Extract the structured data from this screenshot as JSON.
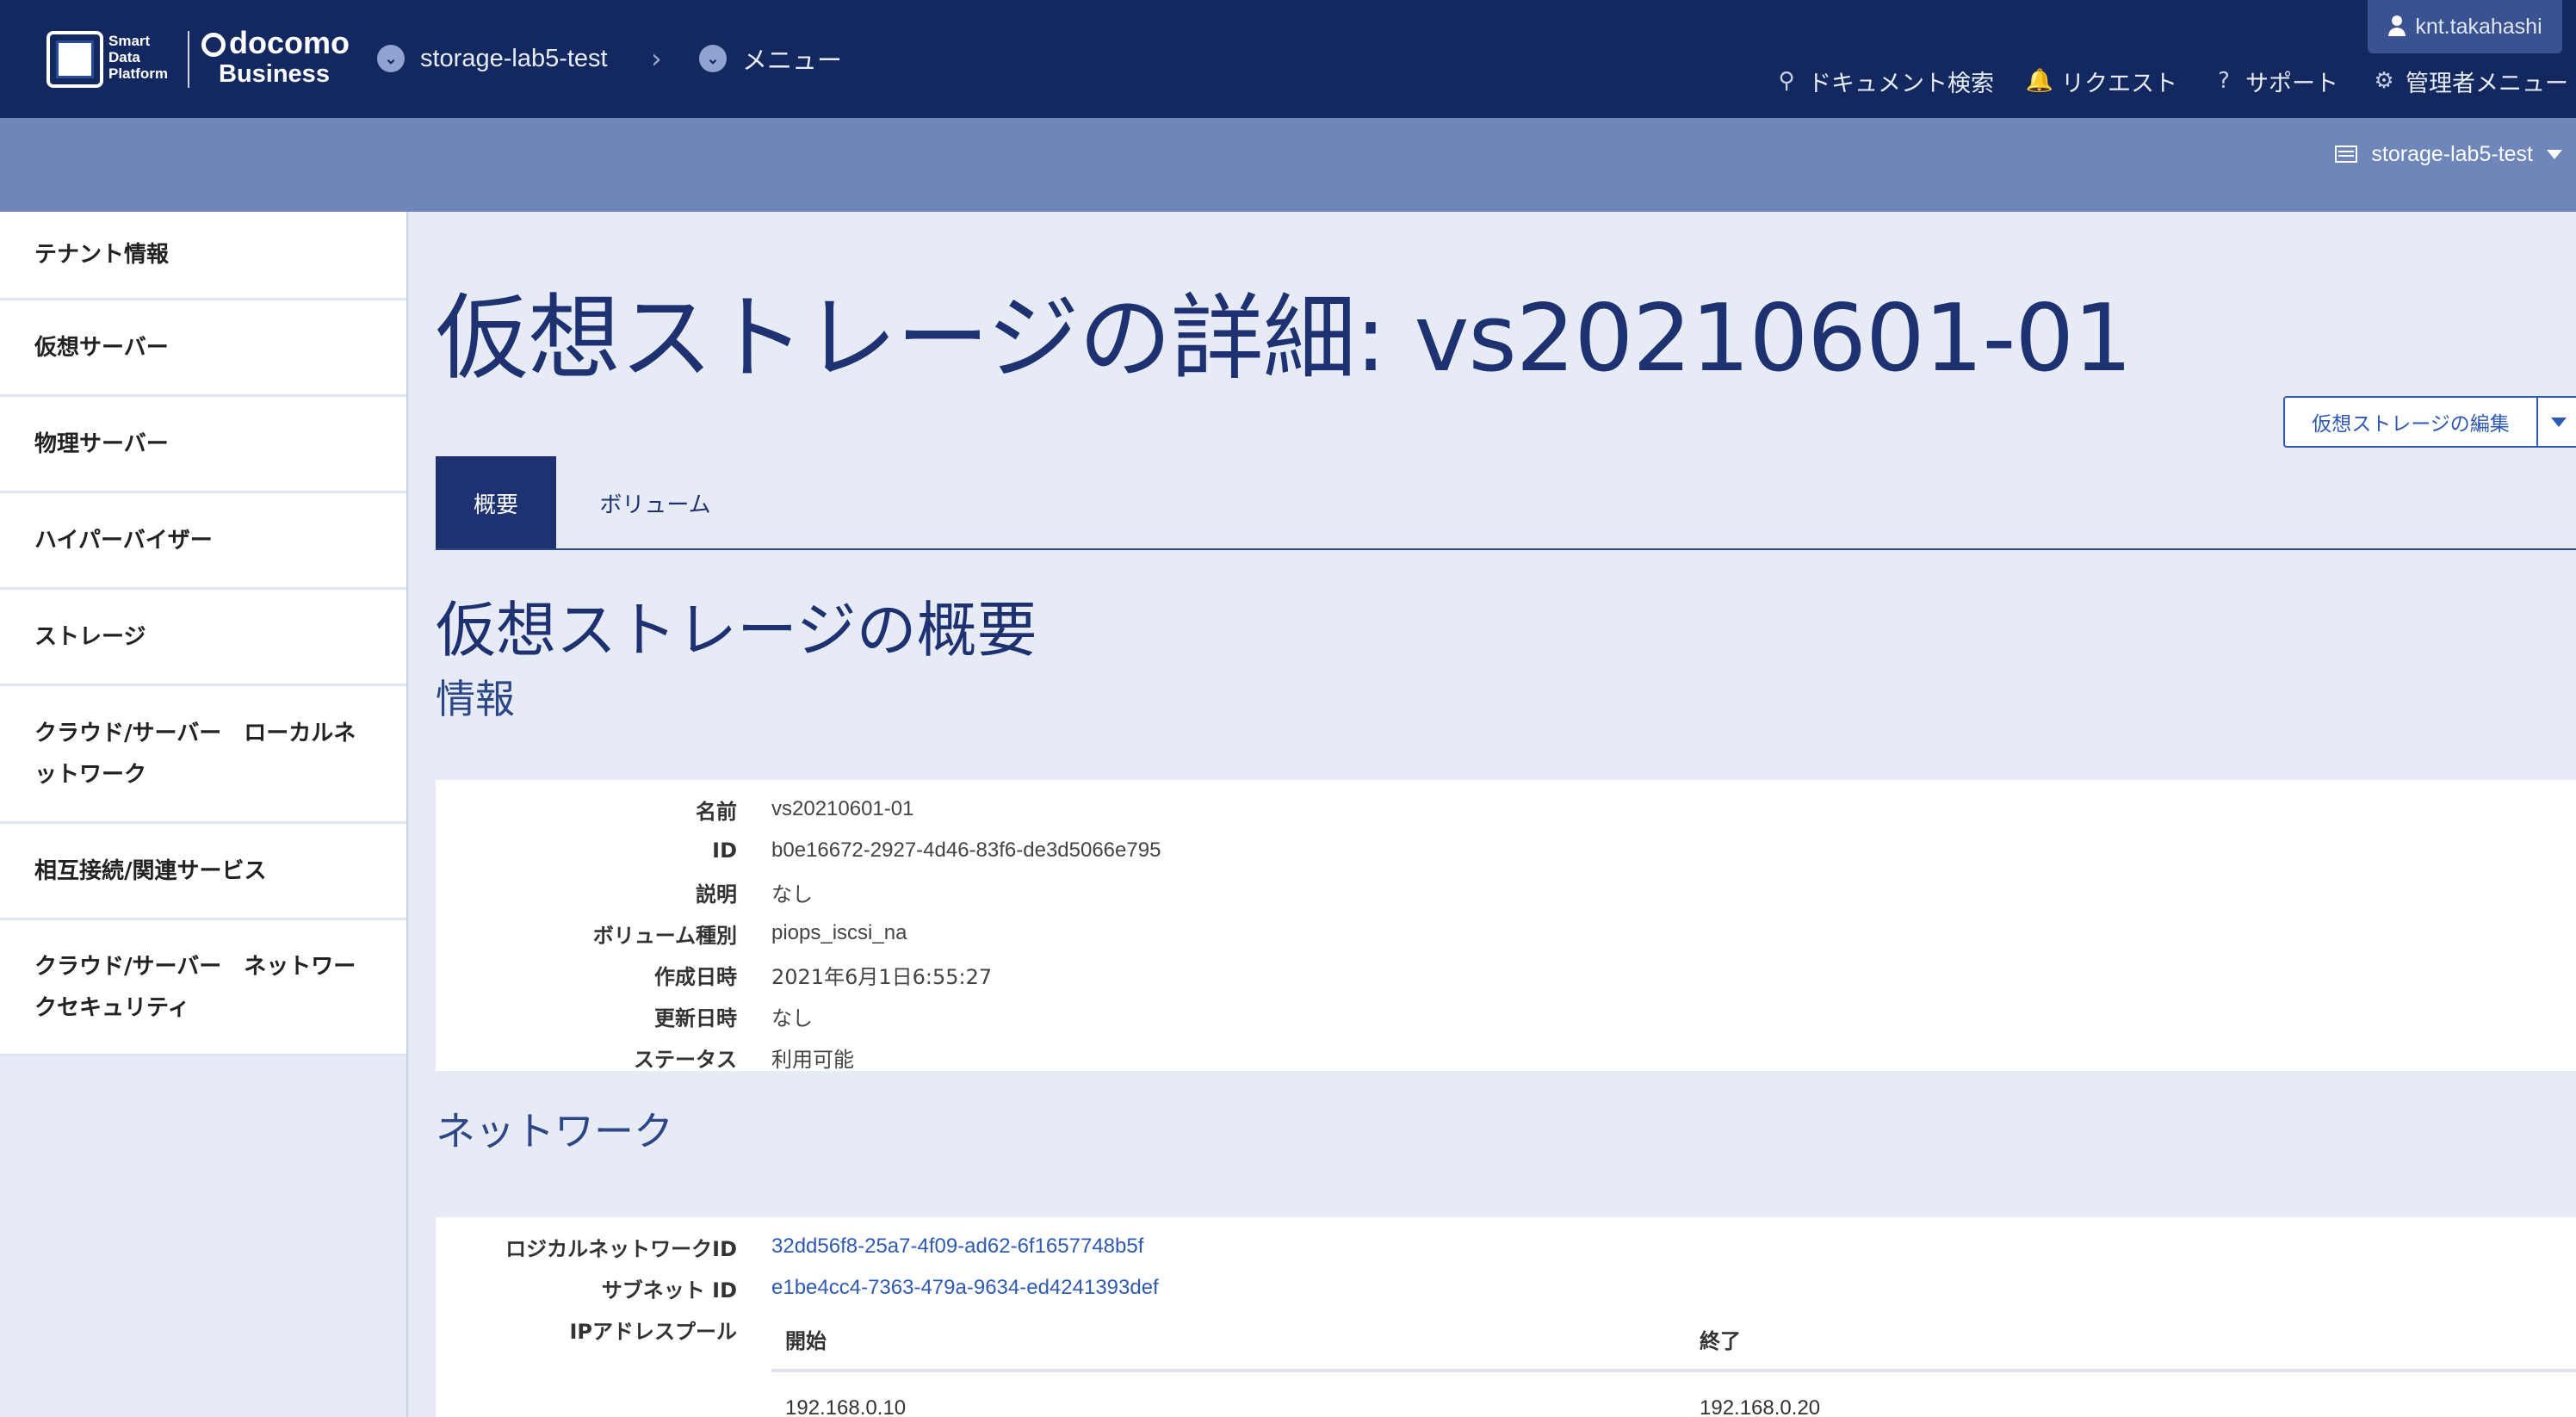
{
  "header": {
    "logo_sdp_lines": [
      "Smart",
      "Data",
      "Platform"
    ],
    "logo_docomo": "docomo",
    "logo_business": "Business",
    "breadcrumb": [
      {
        "label": "storage-lab5-test"
      },
      {
        "label": "メニュー"
      }
    ],
    "user": "knt.takahashi",
    "nav": {
      "docs": "ドキュメント検索",
      "request": "リクエスト",
      "support": "サポート",
      "admin": "管理者メニュー"
    }
  },
  "subheader": {
    "tenant": "storage-lab5-test"
  },
  "sidebar": {
    "items": [
      {
        "label": "テナント情報"
      },
      {
        "label": "仮想サーバー"
      },
      {
        "label": "物理サーバー"
      },
      {
        "label": "ハイパーバイザー"
      },
      {
        "label": "ストレージ"
      },
      {
        "label_line1": "クラウド/サーバー　ローカルネ",
        "label_line2": "ットワーク"
      },
      {
        "label": "相互接続/関連サービス"
      },
      {
        "label_line1": "クラウド/サーバー　ネットワー",
        "label_line2": "クセキュリティ"
      }
    ]
  },
  "main": {
    "title": "仮想ストレージの詳細: vs20210601-01",
    "edit_button": "仮想ストレージの編集",
    "tabs": [
      {
        "label": "概要",
        "active": true
      },
      {
        "label": "ボリューム",
        "active": false
      }
    ],
    "overview_heading": "仮想ストレージの概要",
    "info_heading": "情報",
    "info": [
      {
        "key": "名前",
        "value": "vs20210601-01"
      },
      {
        "key": "ID",
        "value": "b0e16672-2927-4d46-83f6-de3d5066e795"
      },
      {
        "key": "説明",
        "value": "なし"
      },
      {
        "key": "ボリューム種別",
        "value": "piops_iscsi_na"
      },
      {
        "key": "作成日時",
        "value": "2021年6月1日6:55:27"
      },
      {
        "key": "更新日時",
        "value": "なし"
      },
      {
        "key": "ステータス",
        "value": "利用可能"
      }
    ],
    "network_heading": "ネットワーク",
    "network": {
      "logical_network_key": "ロジカルネットワークID",
      "logical_network_value": "32dd56f8-25a7-4f09-ad62-6f1657748b5f",
      "subnet_key": "サブネット ID",
      "subnet_value": "e1be4cc4-7363-479a-9634-ed4241393def",
      "ip_pool_key": "IPアドレスプール",
      "ip_pool_columns": {
        "start": "開始",
        "end": "終了"
      },
      "ip_pool_rows": [
        {
          "start": "192.168.0.10",
          "end": "192.168.0.20"
        }
      ]
    }
  },
  "colors": {
    "header_bg": "#12285f",
    "subheader_bg": "#6e86b9",
    "accent": "#1e3170",
    "link": "#2f5ab4",
    "page_bg": "#e6ebf5"
  }
}
